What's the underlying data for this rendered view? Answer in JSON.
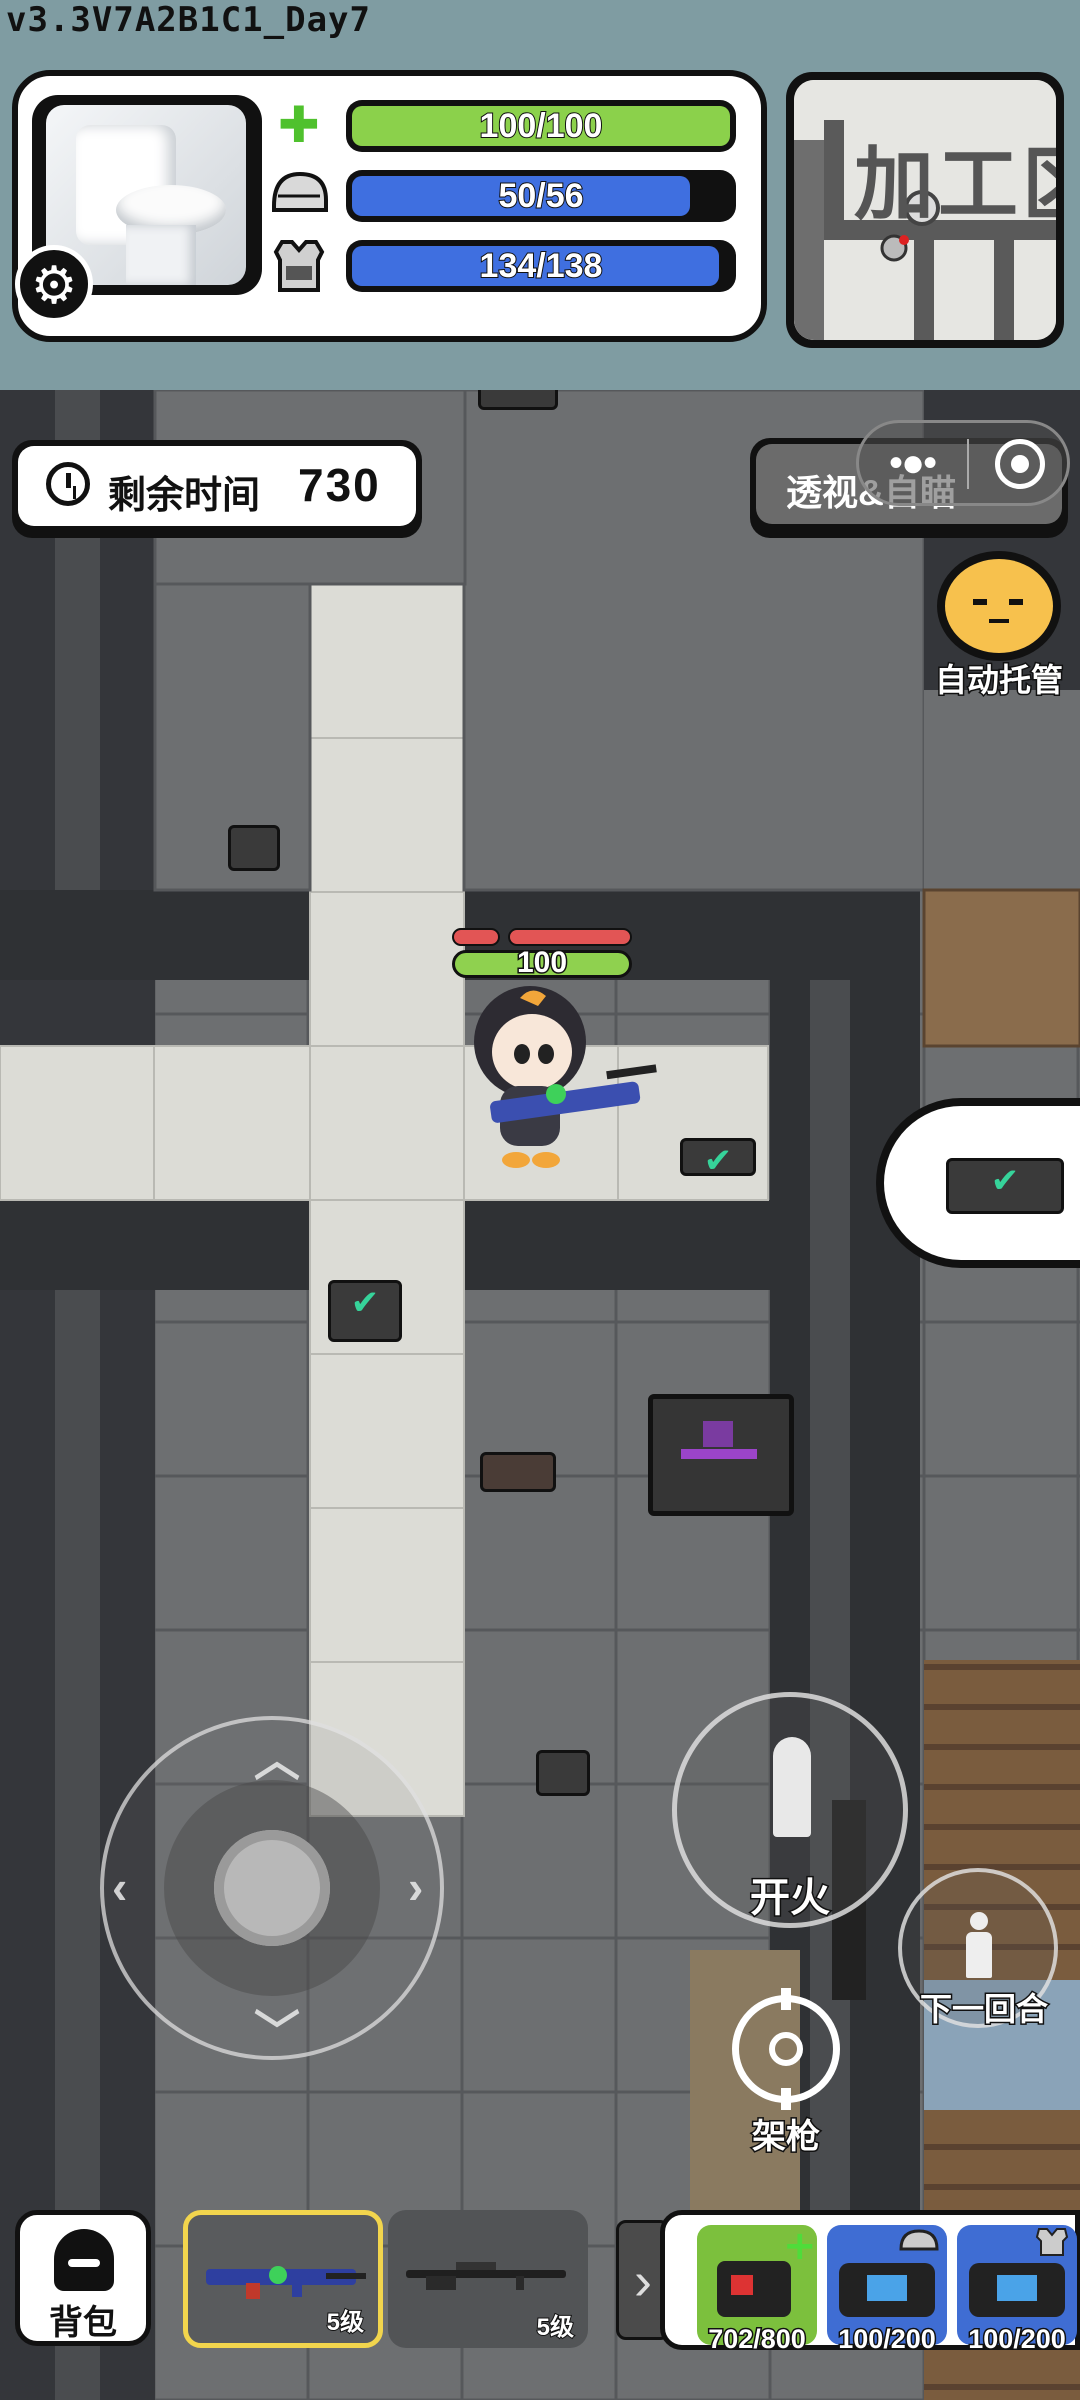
{
  "version": "v3.3V7A2B1C1_Day7",
  "stats": {
    "health": {
      "text": "100/100",
      "value": 100,
      "max": 100,
      "color": "#8bd14b",
      "icon": "green-cross-icon"
    },
    "helmet": {
      "text": "50/56",
      "value": 50,
      "max": 56,
      "color": "#3f6fe0",
      "icon": "helmet-icon"
    },
    "armor": {
      "text": "134/138",
      "value": 134,
      "max": 138,
      "color": "#3f6fe0",
      "icon": "body-armor-icon"
    }
  },
  "minimap": {
    "label": "加工区"
  },
  "timer": {
    "label": "剩余时间",
    "value": "730"
  },
  "xray_button": {
    "label": "透视&自瞄"
  },
  "auto_button": {
    "label": "自动托管"
  },
  "player": {
    "hp": "100"
  },
  "controls": {
    "fire": "开火",
    "next_turn": "下一回合",
    "aim": "架枪"
  },
  "backpack": {
    "label": "背包"
  },
  "weapons": [
    {
      "level": "5级",
      "selected": true
    },
    {
      "level": "5级",
      "selected": false
    }
  ],
  "consumables": [
    {
      "name": "medkit",
      "qty": "702/800"
    },
    {
      "name": "helmet-repair-bag",
      "qty": "100/200"
    },
    {
      "name": "armor-repair-bag",
      "qty": "100/200"
    }
  ]
}
